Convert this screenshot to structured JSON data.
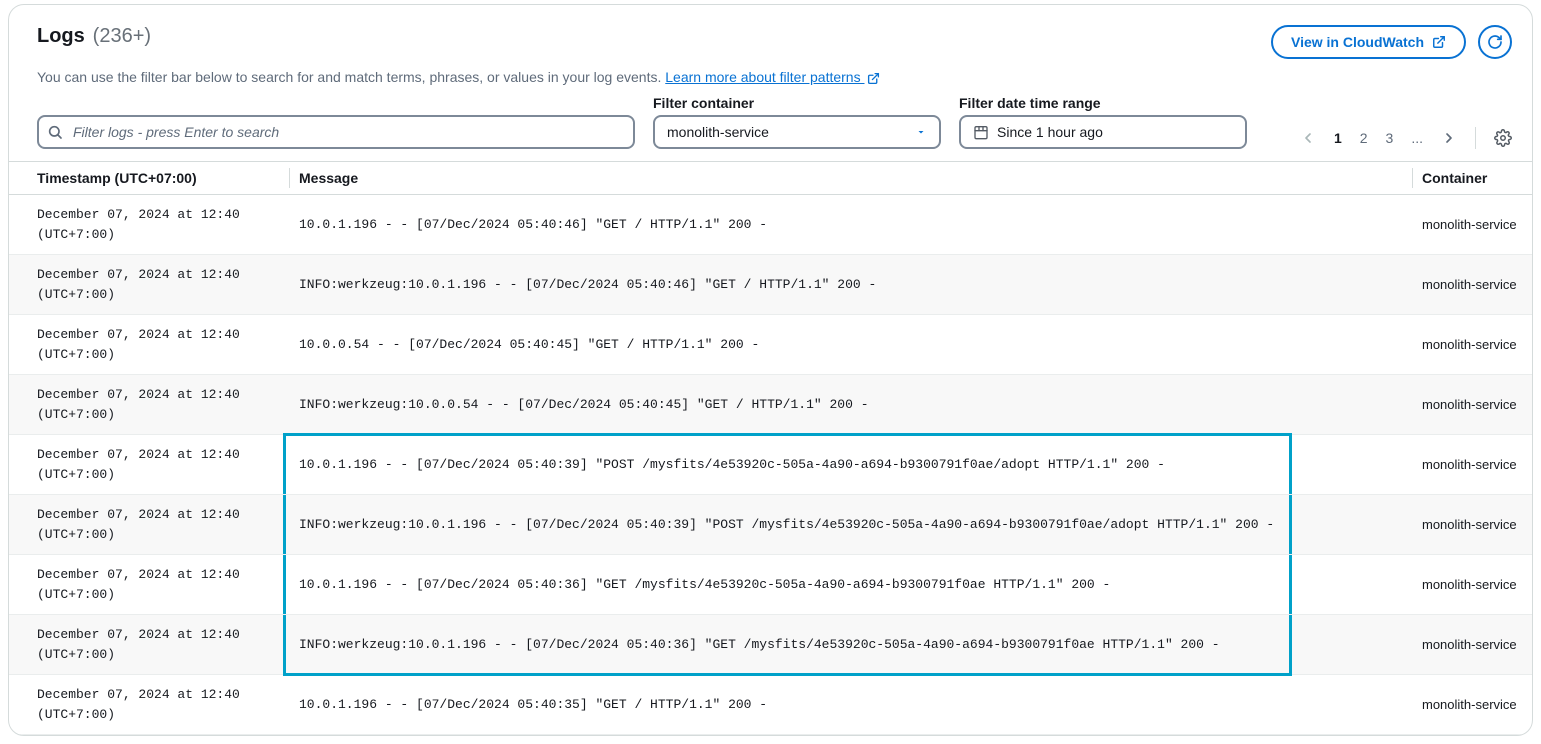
{
  "header": {
    "title": "Logs",
    "count": "(236+)",
    "view_button": "View in CloudWatch"
  },
  "subheader": {
    "text": "You can use the filter bar below to search for and match terms, phrases, or values in your log events. ",
    "link": "Learn more about filter patterns "
  },
  "filters": {
    "search_placeholder": "Filter logs - press Enter to search",
    "container_label": "Filter container",
    "container_value": "monolith-service",
    "date_label": "Filter date time range",
    "date_value": "Since 1 hour ago"
  },
  "pagination": {
    "pages": [
      "1",
      "2",
      "3",
      "..."
    ],
    "current": "1"
  },
  "columns": {
    "timestamp": "Timestamp (UTC+07:00)",
    "message": "Message",
    "container": "Container"
  },
  "rows": [
    {
      "ts1": "December 07, 2024 at 12:40",
      "ts2": "(UTC+7:00)",
      "msg": "10.0.1.196 - - [07/Dec/2024 05:40:46] \"GET / HTTP/1.1\" 200 -",
      "ct": "monolith-service",
      "hl": false
    },
    {
      "ts1": "December 07, 2024 at 12:40",
      "ts2": "(UTC+7:00)",
      "msg": "INFO:werkzeug:10.0.1.196 - - [07/Dec/2024 05:40:46] \"GET / HTTP/1.1\" 200 -",
      "ct": "monolith-service",
      "hl": false
    },
    {
      "ts1": "December 07, 2024 at 12:40",
      "ts2": "(UTC+7:00)",
      "msg": "10.0.0.54 - - [07/Dec/2024 05:40:45] \"GET / HTTP/1.1\" 200 -",
      "ct": "monolith-service",
      "hl": false
    },
    {
      "ts1": "December 07, 2024 at 12:40",
      "ts2": "(UTC+7:00)",
      "msg": "INFO:werkzeug:10.0.0.54 - - [07/Dec/2024 05:40:45] \"GET / HTTP/1.1\" 200 -",
      "ct": "monolith-service",
      "hl": false
    },
    {
      "ts1": "December 07, 2024 at 12:40",
      "ts2": "(UTC+7:00)",
      "msg": "10.0.1.196 - - [07/Dec/2024 05:40:39] \"POST /mysfits/4e53920c-505a-4a90-a694-b9300791f0ae/adopt HTTP/1.1\" 200 -",
      "ct": "monolith-service",
      "hl": true,
      "hl_first": true
    },
    {
      "ts1": "December 07, 2024 at 12:40",
      "ts2": "(UTC+7:00)",
      "msg": "INFO:werkzeug:10.0.1.196 - - [07/Dec/2024 05:40:39] \"POST /mysfits/4e53920c-505a-4a90-a694-b9300791f0ae/adopt HTTP/1.1\" 200 -",
      "ct": "monolith-service",
      "hl": true
    },
    {
      "ts1": "December 07, 2024 at 12:40",
      "ts2": "(UTC+7:00)",
      "msg": "10.0.1.196 - - [07/Dec/2024 05:40:36] \"GET /mysfits/4e53920c-505a-4a90-a694-b9300791f0ae HTTP/1.1\" 200 -",
      "ct": "monolith-service",
      "hl": true
    },
    {
      "ts1": "December 07, 2024 at 12:40",
      "ts2": "(UTC+7:00)",
      "msg": "INFO:werkzeug:10.0.1.196 - - [07/Dec/2024 05:40:36] \"GET /mysfits/4e53920c-505a-4a90-a694-b9300791f0ae HTTP/1.1\" 200 -",
      "ct": "monolith-service",
      "hl": true,
      "hl_last": true
    },
    {
      "ts1": "December 07, 2024 at 12:40",
      "ts2": "(UTC+7:00)",
      "msg": "10.0.1.196 - - [07/Dec/2024 05:40:35] \"GET / HTTP/1.1\" 200 -",
      "ct": "monolith-service",
      "hl": false
    }
  ]
}
